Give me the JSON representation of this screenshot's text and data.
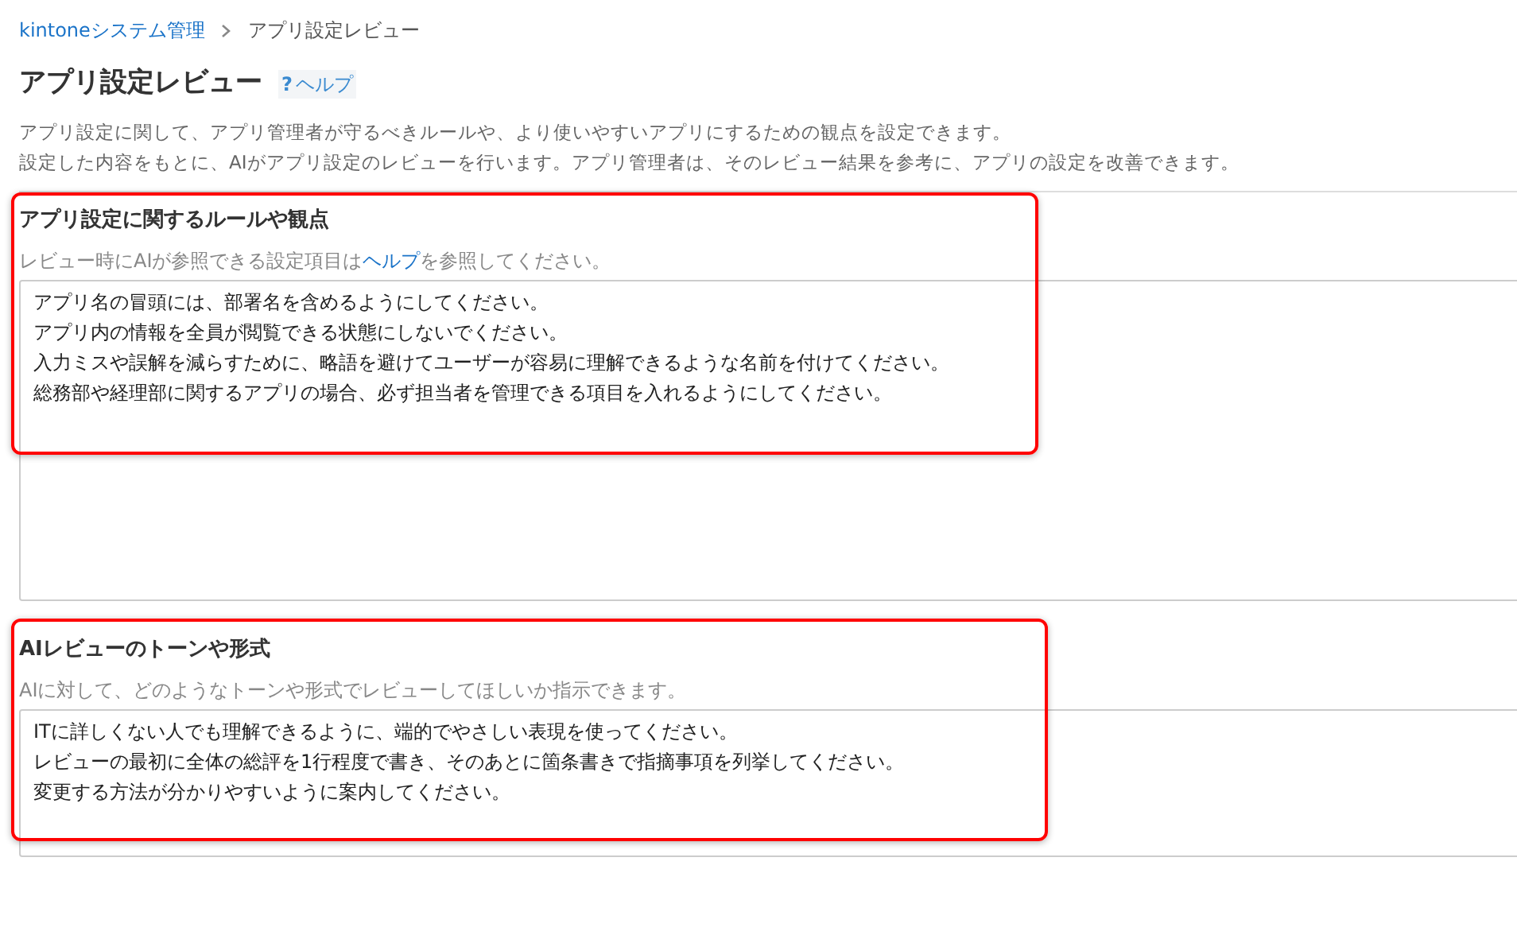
{
  "breadcrumb": [
    {
      "label": "kintoneシステム管理",
      "link": true
    },
    {
      "label": "アプリ設定レビュー",
      "link": false
    }
  ],
  "title": "アプリ設定レビュー",
  "help_link": {
    "icon": "?",
    "label": "ヘルプ"
  },
  "description": [
    "アプリ設定に関して、アプリ管理者が守るべきルールや、より使いやすいアプリにするための観点を設定できます。",
    "設定した内容をもとに、AIがアプリ設定のレビューを行います。アプリ管理者は、そのレビュー結果を参考に、アプリの設定を改善できます。"
  ],
  "sections": [
    {
      "heading": "アプリ設定に関するルールや観点",
      "hint": [
        {
          "text": "レビュー時にAIが参照できる設定項目は",
          "link": false
        },
        {
          "text": "ヘルプ",
          "link": true
        },
        {
          "text": "を参照してください。",
          "link": false
        }
      ],
      "lines": [
        "アプリ名の冒頭には、部署名を含めるようにしてください。",
        "アプリ内の情報を全員が閲覧できる状態にしないでください。",
        "入力ミスや誤解を減らすために、略語を避けてユーザーが容易に理解できるような名前を付けてください。",
        "総務部や経理部に関するアプリの場合、必ず担当者を管理できる項目を入れるようにしてください。"
      ],
      "highlighted": true
    },
    {
      "heading": "AIレビューのトーンや形式",
      "hint": [
        {
          "text": "AIに対して、どのようなトーンや形式でレビューしてほしいか指示できます。",
          "link": false
        }
      ],
      "lines": [
        "ITに詳しくない人でも理解できるように、端的でやさしい表現を使ってください。",
        "レビューの最初に全体の総評を1行程度で書き、そのあとに箇条書きで指摘事項を列挙してください。",
        "変更する方法が分かりやすいように案内してください。"
      ],
      "highlighted": true
    }
  ]
}
